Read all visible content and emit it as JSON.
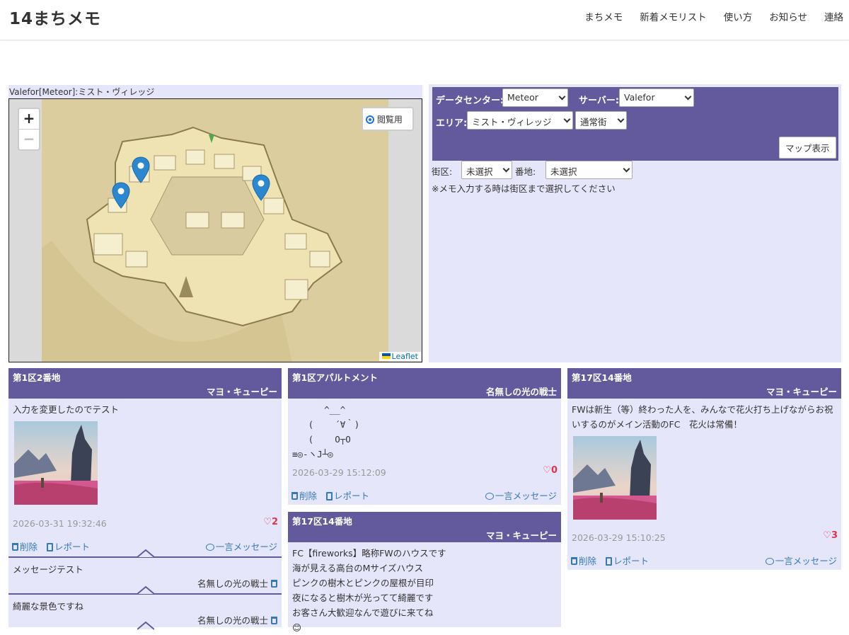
{
  "brand": "14まちメモ",
  "nav": [
    "まちメモ",
    "新着メモリスト",
    "使い方",
    "お知らせ",
    "連絡"
  ],
  "map": {
    "caption": "Valefor[Meteor]:ミスト・ヴィレッジ",
    "zoom_in": "+",
    "zoom_out": "−",
    "view_mode_label": "閲覧用",
    "attribution": "Leaflet"
  },
  "selector": {
    "dc_label": "データセンター:",
    "dc_value": "Meteor",
    "server_label": "サーバー:",
    "server_value": "Valefor",
    "area_label": "エリア:",
    "area_value": "ミスト・ヴィレッジ",
    "area_type_value": "通常街",
    "show_map_button": "マップ表示",
    "ward_label": "街区:",
    "ward_value": "未選択",
    "plot_label": "番地:",
    "plot_value": "未選択",
    "note": "※メモ入力する時は街区まで選択してください"
  },
  "actions": {
    "delete": "削除",
    "report": "レポート",
    "message": "一言メッセージ"
  },
  "cards": [
    {
      "location": "第1区2番地",
      "author": "マヨ・キューピー",
      "text": "入力を変更したのでテスト",
      "date": "2026-03-31 19:32:46",
      "likes": "2",
      "messages": [
        {
          "text": "メッセージテスト",
          "author": "名無しの光の戦士"
        },
        {
          "text": "綺麗な景色ですね",
          "author": "名無しの光の戦士"
        }
      ]
    },
    {
      "location": "第1区アパルトメント",
      "author": "名無しの光の戦士",
      "text": "      ^__^\n   (    ´∀｀)\n   (    O┬O\n≡◎-ヽJ┴◎",
      "date": "2026-03-29 15:12:09",
      "likes": "0"
    },
    {
      "location": "第17区14番地",
      "author": "マヨ・キューピー",
      "text": "FC【fireworks】略称FWのハウスです\n海が見える高台のMサイズハウス\nピンクの樹木とピンクの屋根が目印\n夜になると樹木が光ってて綺麗です\nお客さん大歓迎なんで遊びに来てね\n😊"
    },
    {
      "location": "第17区14番地",
      "author": "マヨ・キューピー",
      "text": "FWは新生（等）終わった人を、みんなで花火打ち上げながらお祝いするのがメイン活動のFC　花火は常備！",
      "date": "2026-03-29 15:10:25",
      "likes": "3"
    }
  ]
}
